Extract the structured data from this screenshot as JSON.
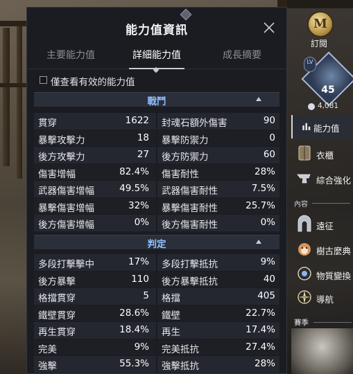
{
  "panel": {
    "title": "能力值資訊",
    "tabs": [
      {
        "label": "主要能力值",
        "active": false
      },
      {
        "label": "詳細能力值",
        "active": true
      },
      {
        "label": "成長摘要",
        "active": false
      }
    ],
    "filter_label": "僅查看有效的能力值",
    "filter_checked": false,
    "sections": [
      {
        "title": "戰鬥",
        "rows": [
          {
            "l_label": "貫穿",
            "l_value": "1622",
            "r_label": "封魂石額外傷害",
            "r_value": "90"
          },
          {
            "l_label": "暴擊攻擊力",
            "l_value": "18",
            "r_label": "暴擊防禦力",
            "r_value": "0"
          },
          {
            "l_label": "後方攻擊力",
            "l_value": "27",
            "r_label": "後方防禦力",
            "r_value": "60"
          },
          {
            "l_label": "傷害增幅",
            "l_value": "82.4%",
            "r_label": "傷害耐性",
            "r_value": "28%"
          },
          {
            "l_label": "武器傷害增幅",
            "l_value": "49.5%",
            "r_label": "武器傷害耐性",
            "r_value": "7.5%"
          },
          {
            "l_label": "暴擊傷害增幅",
            "l_value": "32%",
            "r_label": "暴擊傷害耐性",
            "r_value": "25.7%"
          },
          {
            "l_label": "後方傷害增幅",
            "l_value": "0%",
            "r_label": "後方傷害耐性",
            "r_value": "0%"
          }
        ]
      },
      {
        "title": "判定",
        "rows": [
          {
            "l_label": "多段打擊擊中",
            "l_value": "17%",
            "r_label": "多段打擊抵抗",
            "r_value": "9%"
          },
          {
            "l_label": "後方暴擊",
            "l_value": "110",
            "r_label": "後方暴擊抵抗",
            "r_value": "40"
          },
          {
            "l_label": "格擋貫穿",
            "l_value": "5",
            "r_label": "格擋",
            "r_value": "405"
          },
          {
            "l_label": "鐵壁貫穿",
            "l_value": "28.6%",
            "r_label": "鐵壁",
            "r_value": "22.7%"
          },
          {
            "l_label": "再生貫穿",
            "l_value": "18.4%",
            "r_label": "再生",
            "r_value": "17.4%"
          },
          {
            "l_label": "完美",
            "l_value": "9%",
            "r_label": "完美抵抗",
            "r_value": "27.4%"
          },
          {
            "l_label": "強擊",
            "l_value": "55.3%",
            "r_label": "強擊抵抗",
            "r_value": "28%"
          }
        ]
      }
    ]
  },
  "side_menu": {
    "subscribe": {
      "label": "訂閱",
      "icon": "M"
    },
    "level": {
      "badge": "LV",
      "value": "45"
    },
    "combat_power": "4,081",
    "items": [
      {
        "label": "能力值",
        "icon": "bar-chart-icon",
        "active": true
      },
      {
        "label": "衣櫃",
        "icon": "wardrobe-icon",
        "active": false
      },
      {
        "label": "綜合強化",
        "icon": "anvil-icon",
        "active": false
      }
    ],
    "content_caption": "內容",
    "content_items": [
      {
        "label": "遠征",
        "icon": "gate-icon"
      },
      {
        "label": "樹古麼典",
        "icon": "dog-icon"
      },
      {
        "label": "物質變換",
        "icon": "orb-icon"
      },
      {
        "label": "導航",
        "icon": "compass-icon"
      }
    ],
    "season_caption": "賽季"
  },
  "colors": {
    "panel_bg": "#1a1c22",
    "section_title": "#8fc0ff",
    "row_odd": "#24272f",
    "row_even": "#1d1f25"
  }
}
